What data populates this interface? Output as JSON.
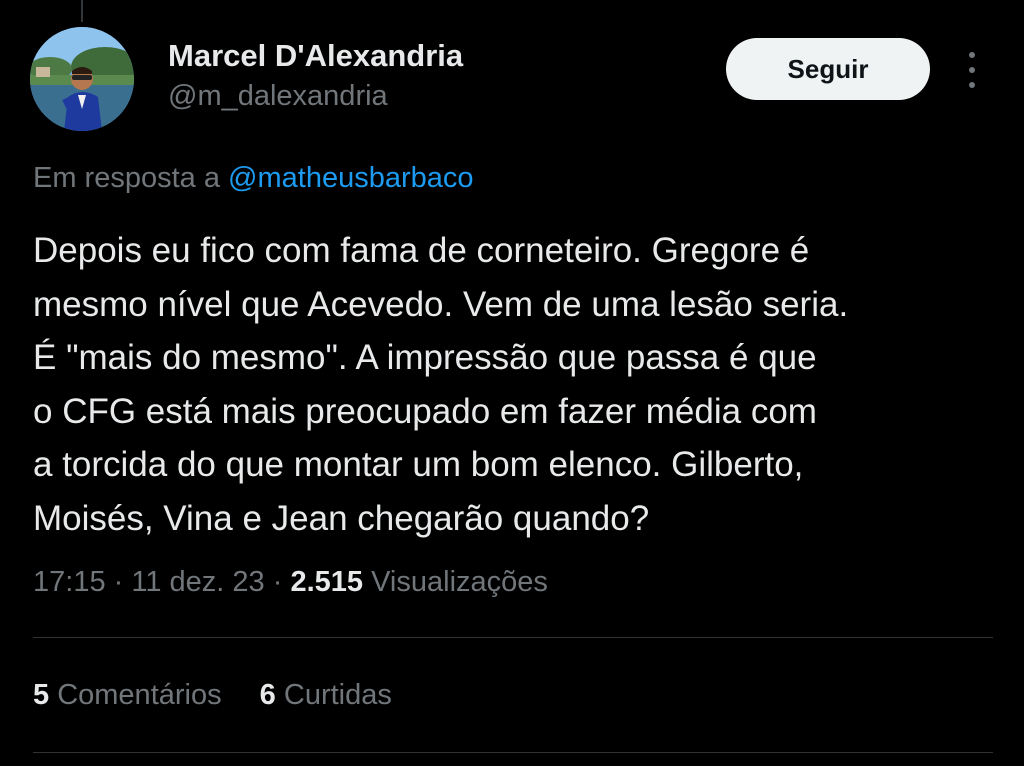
{
  "author": {
    "name": "Marcel D'Alexandria",
    "handle": "@m_dalexandria"
  },
  "follow_button": {
    "label": "Seguir"
  },
  "icons": {
    "more": "more-vertical-icon",
    "avatar": "profile-photo"
  },
  "reply": {
    "prefix": "Em resposta a",
    "mention": "@matheusbarbaco"
  },
  "tweet": {
    "lines": [
      "Depois eu fico com fama de corneteiro. Gregore é",
      "mesmo nível que Acevedo. Vem de uma lesão seria.",
      "É \"mais do mesmo\". A impressão que passa é que",
      "o CFG está mais preocupado em fazer média com",
      "a torcida do que montar um bom elenco. Gilberto,",
      "Moisés, Vina e Jean chegarão quando?"
    ]
  },
  "meta": {
    "time": "17:15",
    "separator": "·",
    "date": "11 dez. 23",
    "views_count": "2.515",
    "views_label": "Visualizações"
  },
  "stats": {
    "comments_count": "5",
    "comments_label": "Comentários",
    "likes_count": "6",
    "likes_label": "Curtidas"
  },
  "colors": {
    "background": "#000000",
    "text_primary": "#e7e9ea",
    "text_secondary": "#71767b",
    "accent": "#1d9bf0",
    "divider": "#2f3336",
    "button_bg": "#eff3f4"
  }
}
